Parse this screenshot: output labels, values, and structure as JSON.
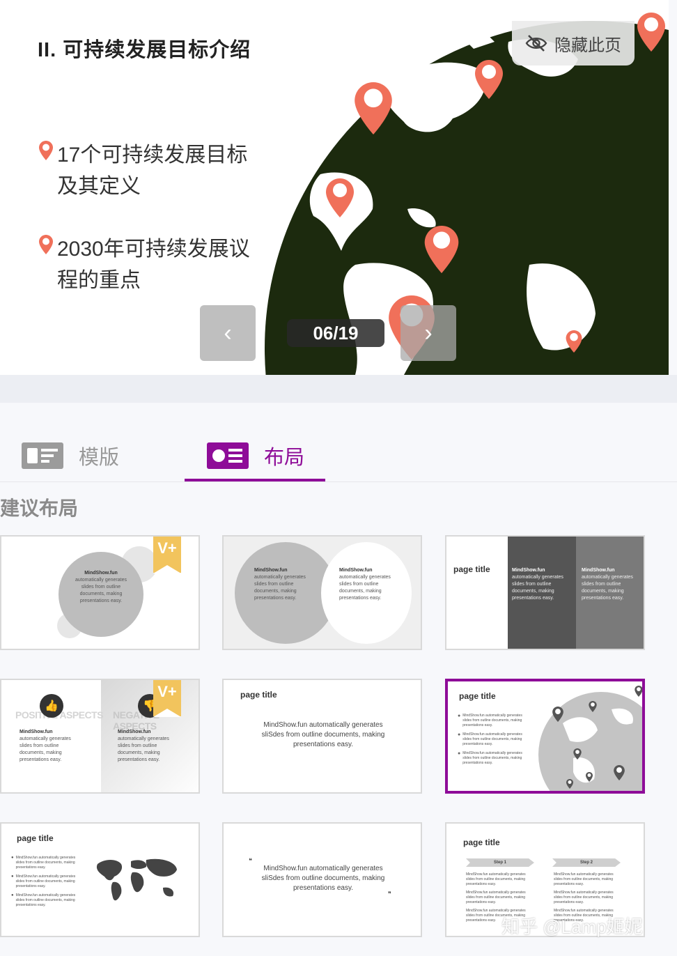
{
  "slide": {
    "title": "II. 可持续发展目标介绍",
    "bullets": [
      "17个可持续发展目标及其定义",
      "2030年可持续发展议程的重点"
    ],
    "hide_label": "隐藏此页",
    "counter": "06/19",
    "prev_glyph": "‹",
    "next_glyph": "›"
  },
  "tabs": {
    "template_label": "模版",
    "layout_label": "布局"
  },
  "section_title": "建议布局",
  "cards": {
    "c1": {
      "badge": "V+",
      "name": "MindShow.fun",
      "text": "automatically generates slides from outline documents, making presentations easy."
    },
    "c2": {
      "left_name": "MindShow.fun",
      "left_text": "automatically generates slides from outline documents, making presentations easy.",
      "right_name": "MindShow.fun",
      "right_text": "automatically generates slides from outline documents, making presentations easy."
    },
    "c3": {
      "title": "page title",
      "col1_name": "MindShow.fun",
      "col1_text": "automatically generates slides from outline documents, making presentations easy.",
      "col2_name": "MindShow.fun",
      "col2_text": "automatically generates slides from outline documents, making presentations easy."
    },
    "c4": {
      "badge": "V+",
      "left_heading": "POSITIVE ASPECTS",
      "right_heading": "NEGATIVE ASPECTS",
      "left_name": "MindShow.fun",
      "left_text": "automatically generates slides from outline documents, making presentations easy.",
      "right_name": "MindShow.fun",
      "right_text": "automatically generates slides from outline documents, making presentations easy."
    },
    "c5": {
      "title": "page title",
      "text": "MindShow.fun automatically generates sliSdes from outline documents, making presentations easy."
    },
    "c6": {
      "title": "page title",
      "items": [
        "MindShow.fun automatically generates slides from outline documents, making presentations easy.",
        "MindShow.fun automatically generates slides from outline documents, making presentations easy.",
        "MindShow.fun automatically generates slides from outline documents, making presentations easy."
      ]
    },
    "c7": {
      "title": "page title",
      "items": [
        "MindShow.fun automatically generates slides from outline documents, making presentations easy.",
        "MindShow.fun automatically generates slides from outline documents, making presentations easy.",
        "MindShow.fun automatically generates slides from outline documents, making presentations easy."
      ]
    },
    "c8": {
      "open_quote": "❝",
      "close_quote": "❞",
      "text": "MindShow.fun automatically generates sliSdes from outline documents, making presentations easy."
    },
    "c9": {
      "title": "page title",
      "step1": "Step 1",
      "step2": "Step 2",
      "item": "MindShow.fun automatically generates slides from outline documents, making presentations easy."
    }
  },
  "watermark": "知乎 @Lamp姬妮",
  "colors": {
    "accent": "#8e0c98",
    "pin": "#f0705a",
    "globe": "#1c2a0e"
  }
}
